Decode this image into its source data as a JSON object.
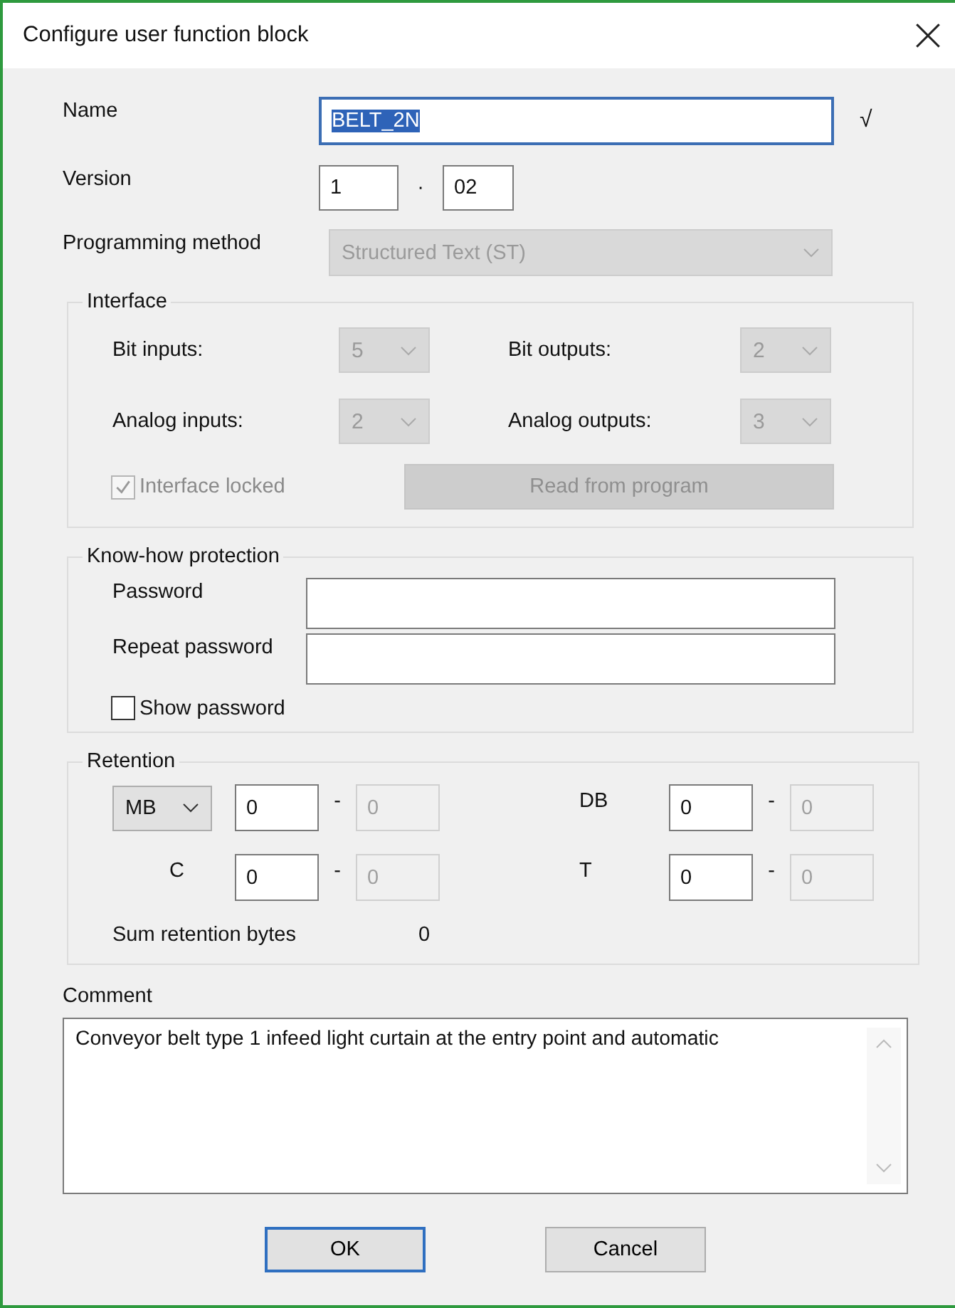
{
  "window": {
    "title": "Configure user function block"
  },
  "name": {
    "label": "Name",
    "value": "BELT_2N",
    "selected": true,
    "valid_mark": "√"
  },
  "version": {
    "label": "Version",
    "major": "1",
    "separator": "·",
    "minor": "02"
  },
  "programming_method": {
    "label": "Programming method",
    "value": "Structured Text (ST)",
    "disabled": true
  },
  "interface": {
    "title": "Interface",
    "fields": [
      {
        "label": "Bit inputs:",
        "value": "5",
        "disabled": true
      },
      {
        "label": "Bit outputs:",
        "value": "2",
        "disabled": true
      },
      {
        "label": "Analog inputs:",
        "value": "2",
        "disabled": true
      },
      {
        "label": "Analog outputs:",
        "value": "3",
        "disabled": true
      }
    ],
    "interface_locked": {
      "label": "Interface locked",
      "checked": true,
      "disabled": true
    },
    "read_button": {
      "label": "Read from program",
      "disabled": true
    }
  },
  "know_how": {
    "title": "Know-how protection",
    "password": {
      "label": "Password"
    },
    "repeat_password": {
      "label": "Repeat password"
    },
    "show_password": {
      "label": "Show password",
      "checked": false
    }
  },
  "retention": {
    "title": "Retention",
    "areas": [
      {
        "kind": "select",
        "label": "MB",
        "start": "0",
        "separator": "-",
        "end": "0"
      },
      {
        "kind": "label",
        "label": "DB",
        "start": "0",
        "separator": "-",
        "end": "0"
      },
      {
        "kind": "label",
        "label": "C",
        "start": "0",
        "separator": "-",
        "end": "0"
      },
      {
        "kind": "label",
        "label": "T",
        "start": "0",
        "separator": "-",
        "end": "0"
      }
    ],
    "sum_label": "Sum retention bytes",
    "sum_value": "0"
  },
  "comment": {
    "label": "Comment",
    "value": "Conveyor belt type 1 infeed light curtain at the entry point and automatic"
  },
  "buttons": [
    {
      "label": "OK",
      "default": true
    },
    {
      "label": "Cancel",
      "default": false
    }
  ]
}
